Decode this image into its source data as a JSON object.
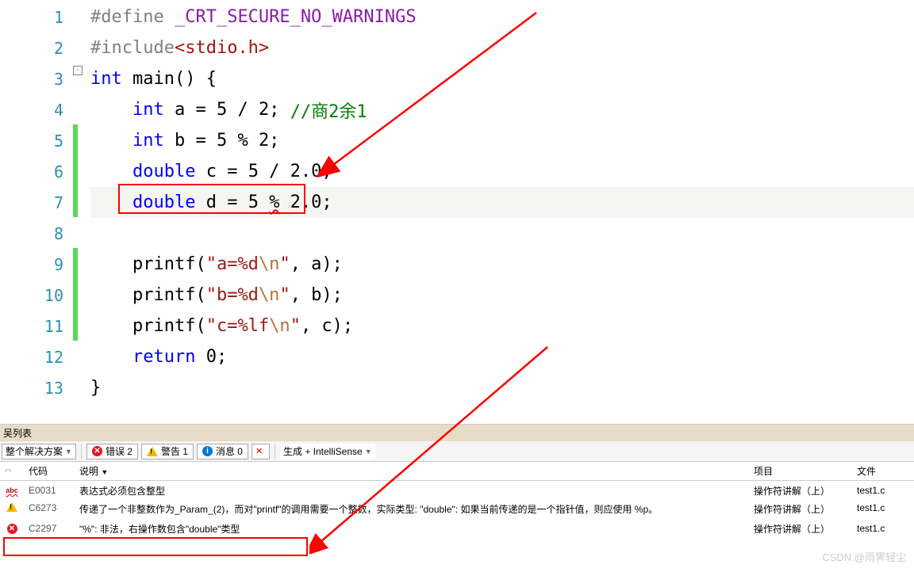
{
  "code": {
    "lines": [
      {
        "n": "1",
        "ind": "",
        "tokens": [
          [
            "pp",
            "#define"
          ],
          [
            "plain",
            " "
          ],
          [
            "macro",
            "_CRT_SECURE_NO_WARNINGS"
          ]
        ]
      },
      {
        "n": "2",
        "ind": "",
        "tokens": [
          [
            "pp",
            "#include"
          ],
          [
            "str",
            "<stdio.h>"
          ]
        ]
      },
      {
        "n": "3",
        "ind": "",
        "tokens": [
          [
            "kw",
            "int"
          ],
          [
            "plain",
            " main() {"
          ]
        ]
      },
      {
        "n": "4",
        "ind": "    ",
        "tokens": [
          [
            "kw",
            "int"
          ],
          [
            "plain",
            " a = 5 / 2; "
          ],
          [
            "comment",
            "//商2余1"
          ]
        ]
      },
      {
        "n": "5",
        "ind": "    ",
        "tokens": [
          [
            "kw",
            "int"
          ],
          [
            "plain",
            " b = 5 % 2;"
          ]
        ]
      },
      {
        "n": "6",
        "ind": "    ",
        "tokens": [
          [
            "kw",
            "double"
          ],
          [
            "plain",
            " c = 5 / 2.0;"
          ]
        ]
      },
      {
        "n": "7",
        "ind": "    ",
        "tokens": [
          [
            "kw",
            "double"
          ],
          [
            "plain",
            " d = 5 "
          ],
          [
            "squiggle",
            "%"
          ],
          [
            "plain",
            " 2.0;"
          ]
        ]
      },
      {
        "n": "8",
        "ind": "",
        "tokens": []
      },
      {
        "n": "9",
        "ind": "    ",
        "tokens": [
          [
            "plain",
            "printf("
          ],
          [
            "str",
            "\"a=%d"
          ],
          [
            "esc",
            "\\n"
          ],
          [
            "str",
            "\""
          ],
          [
            "plain",
            ", a);"
          ]
        ]
      },
      {
        "n": "10",
        "ind": "    ",
        "tokens": [
          [
            "plain",
            "printf("
          ],
          [
            "str",
            "\"b=%d"
          ],
          [
            "esc",
            "\\n"
          ],
          [
            "str",
            "\""
          ],
          [
            "plain",
            ", b);"
          ]
        ]
      },
      {
        "n": "11",
        "ind": "    ",
        "tokens": [
          [
            "plain",
            "printf("
          ],
          [
            "str",
            "\"c=%lf"
          ],
          [
            "esc",
            "\\n"
          ],
          [
            "str",
            "\""
          ],
          [
            "plain",
            ", c);"
          ]
        ]
      },
      {
        "n": "12",
        "ind": "    ",
        "tokens": [
          [
            "kw",
            "return"
          ],
          [
            "plain",
            " 0;"
          ]
        ]
      },
      {
        "n": "13",
        "ind": "",
        "tokens": [
          [
            "plain",
            "}"
          ]
        ]
      }
    ],
    "fold_marker": "-",
    "current_line_index": 6
  },
  "panel": {
    "title": "吴列表",
    "solution_combo": "整个解决方案",
    "errors_label": "错误 2",
    "warnings_label": "警告 1",
    "messages_label": "消息 0",
    "build_combo": "生成 + IntelliSense"
  },
  "columns": {
    "code": "代码",
    "desc": "说明",
    "proj": "项目",
    "file": "文件"
  },
  "errors": [
    {
      "icon": "abc",
      "code": "E0031",
      "desc": "表达式必须包含整型",
      "proj": "操作符讲解（上）",
      "file": "test1.c"
    },
    {
      "icon": "warn",
      "code": "C6273",
      "desc": "传递了一个非整数作为_Param_(2)，而对\"printf\"的调用需要一个整数，实际类型: \"double\": 如果当前传递的是一个指针值，则应使用 %p。",
      "proj": "操作符讲解（上）",
      "file": "test1.c"
    },
    {
      "icon": "err",
      "code": "C2297",
      "desc": "\"%\": 非法，右操作数包含\"double\"类型",
      "proj": "操作符讲解（上）",
      "file": "test1.c"
    }
  ],
  "watermark": "CSDN @雨霁轻尘"
}
